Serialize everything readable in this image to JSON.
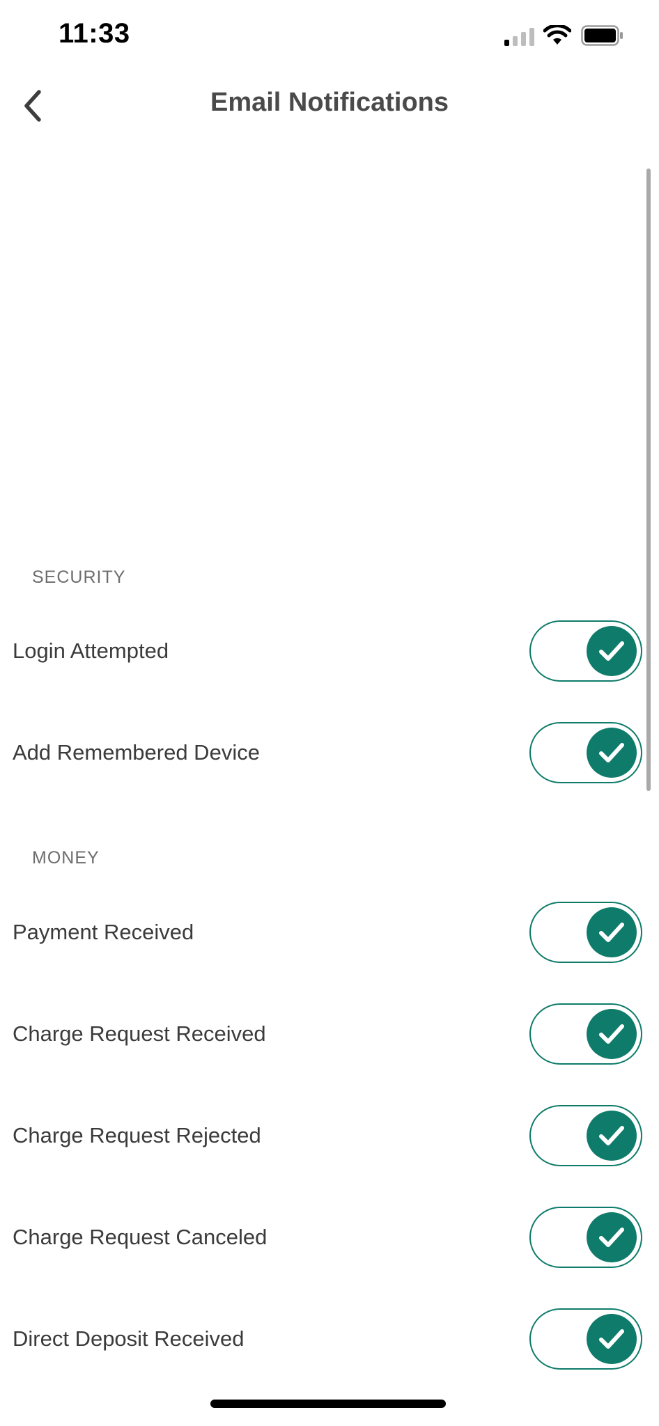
{
  "status_bar": {
    "time": "11:33",
    "icons": [
      "signal-icon",
      "wifi-icon",
      "battery-icon"
    ]
  },
  "nav": {
    "back_icon": "chevron-left-icon",
    "title": "Email Notifications"
  },
  "colors": {
    "accent": "#0f7b6a",
    "section_header": "#6d6d6d",
    "label": "#3b3b3b",
    "title": "#4a4a4a"
  },
  "sections": [
    {
      "header": "SECURITY",
      "items": [
        {
          "label": "Login Attempted",
          "enabled": true
        },
        {
          "label": "Add Remembered Device",
          "enabled": true
        }
      ]
    },
    {
      "header": "MONEY",
      "items": [
        {
          "label": "Payment Received",
          "enabled": true
        },
        {
          "label": "Charge Request Received",
          "enabled": true
        },
        {
          "label": "Charge Request Rejected",
          "enabled": true
        },
        {
          "label": "Charge Request Canceled",
          "enabled": true
        },
        {
          "label": "Direct Deposit Received",
          "enabled": true
        }
      ]
    }
  ]
}
